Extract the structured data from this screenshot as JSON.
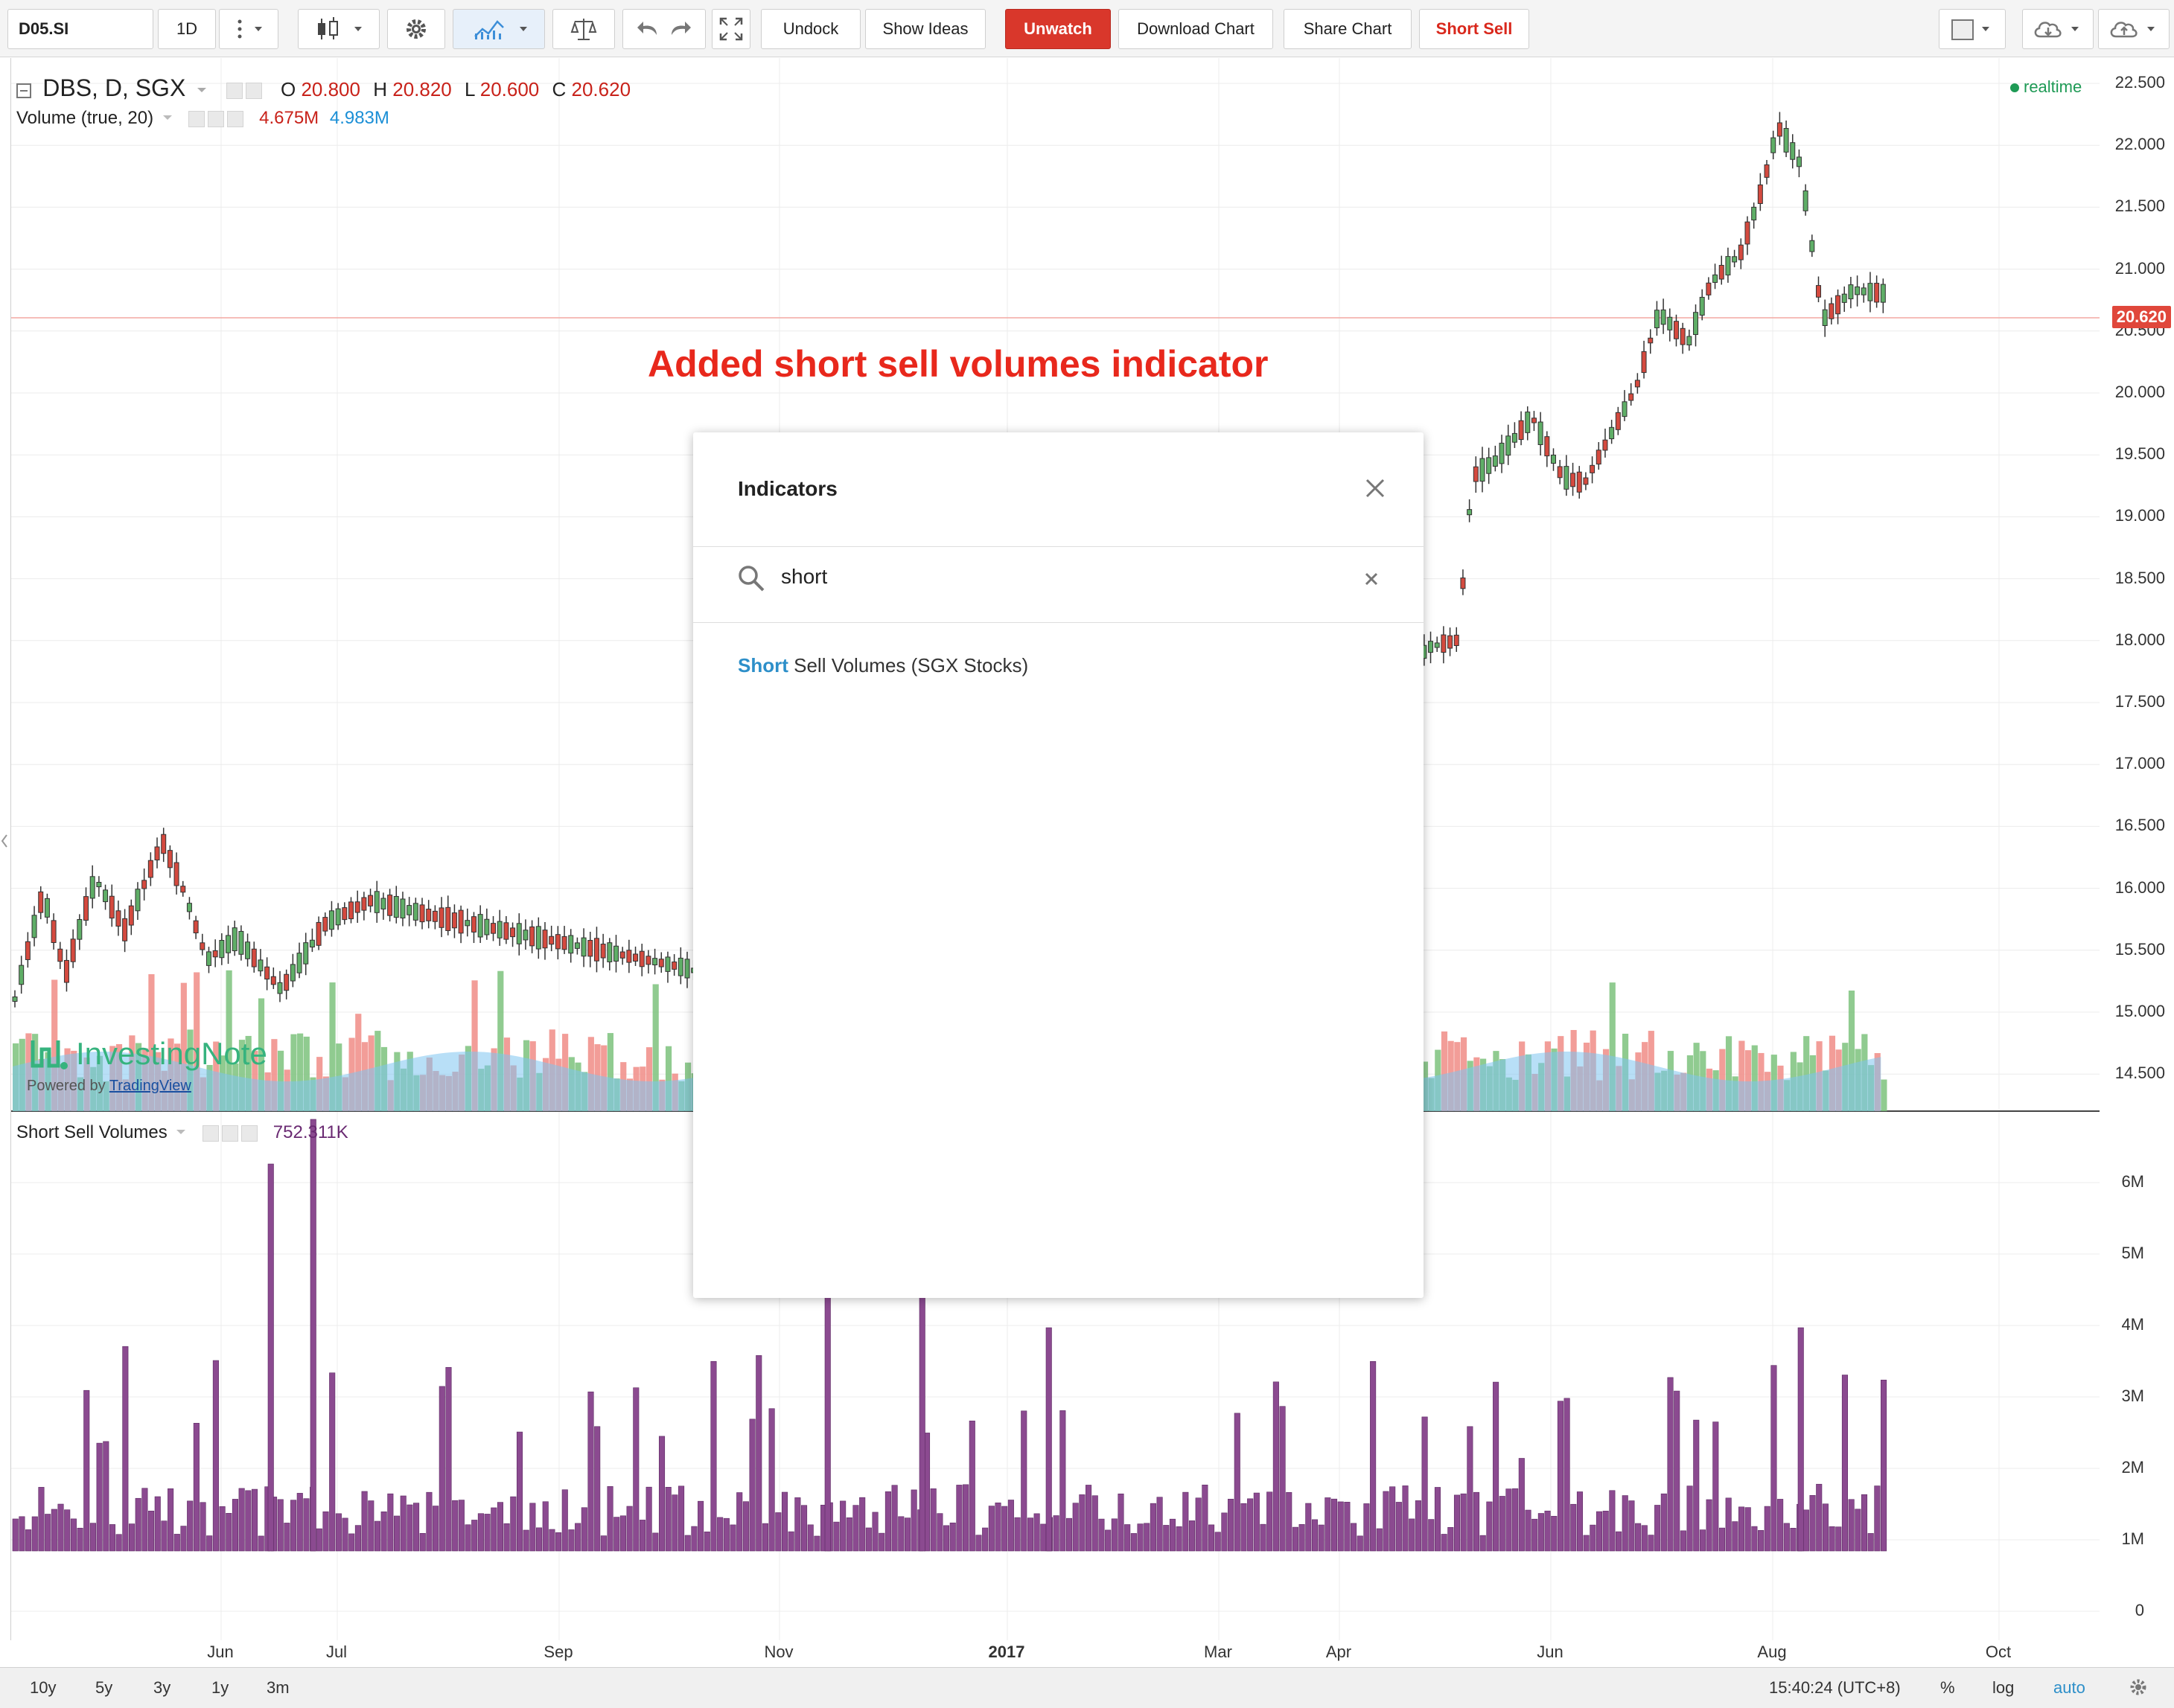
{
  "toolbar": {
    "symbol": "D05.SI",
    "interval": "1D",
    "undock": "Undock",
    "show_ideas": "Show Ideas",
    "unwatch": "Unwatch",
    "download_chart": "Download Chart",
    "share_chart": "Share Chart",
    "short_sell": "Short Sell"
  },
  "legend": {
    "main_title": "DBS, D, SGX",
    "o_label": "O",
    "o": "20.800",
    "h_label": "H",
    "h": "20.820",
    "l_label": "L",
    "l": "20.600",
    "c_label": "C",
    "c": "20.620",
    "volume_title": "Volume (true, 20)",
    "volume_value": "4.675M",
    "volume_ma": "4.983M",
    "realtime": "realtime"
  },
  "short_sell_pane": {
    "title": "Short Sell Volumes",
    "value": "752.311K"
  },
  "annotation": "Added short sell volumes indicator",
  "modal": {
    "title": "Indicators",
    "search_value": "short",
    "result_highlight": "Short",
    "result_rest": " Sell Volumes (SGX Stocks)"
  },
  "logo": {
    "brand": "InvestingNote",
    "powered_prefix": "Powered by ",
    "powered_link": "TradingView"
  },
  "price_axis": {
    "ticks": [
      "22.500",
      "22.000",
      "21.500",
      "21.000",
      "20.500",
      "20.000",
      "19.500",
      "19.000",
      "18.500",
      "18.000",
      "17.500",
      "17.000",
      "16.500",
      "16.000",
      "15.500",
      "15.000",
      "14.500"
    ],
    "current_price": "20.620"
  },
  "volume_axis": {
    "ticks": [
      "6M",
      "5M",
      "4M",
      "3M",
      "2M",
      "1M",
      "0"
    ]
  },
  "time_axis": {
    "labels": [
      "Jun",
      "Jul",
      "Sep",
      "Nov",
      "2017",
      "Mar",
      "Apr",
      "Jun",
      "Aug",
      "Oct"
    ]
  },
  "bottom_bar": {
    "ranges": [
      "10y",
      "5y",
      "3y",
      "1y",
      "3m"
    ],
    "clock": "15:40:24 (UTC+8)",
    "percent": "%",
    "log": "log",
    "auto": "auto"
  },
  "colors": {
    "up": "#26a69a",
    "down": "#e0473b",
    "short_sell_bar": "#8b4a90",
    "volume_ma": "#7ec5f0",
    "accent_red": "#d9372b"
  }
}
